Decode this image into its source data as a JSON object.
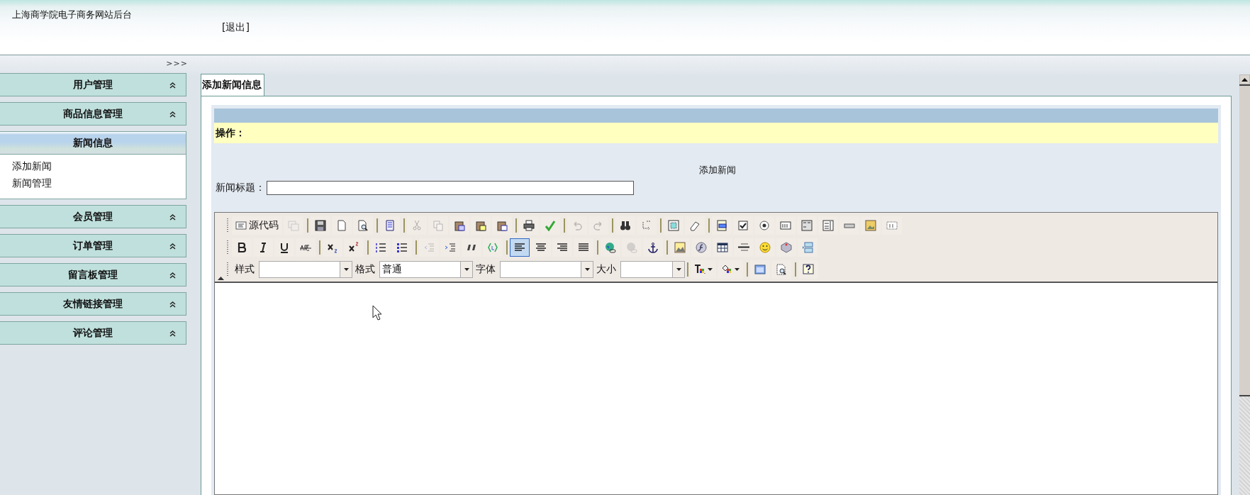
{
  "header": {
    "title": "上海商学院电子商务网站后台",
    "logout": "[退出]"
  },
  "sidebar": {
    "toggle": ">>>",
    "sections": [
      {
        "title": "用户管理",
        "expanded": false
      },
      {
        "title": "商品信息管理",
        "expanded": false
      },
      {
        "title": "新闻信息",
        "expanded": true,
        "items": [
          "添加新闻",
          "新闻管理"
        ]
      },
      {
        "title": "会员管理",
        "expanded": false
      },
      {
        "title": "订单管理",
        "expanded": false
      },
      {
        "title": "留言板管理",
        "expanded": false
      },
      {
        "title": "友情链接管理",
        "expanded": false
      },
      {
        "title": "评论管理",
        "expanded": false
      }
    ]
  },
  "tabs": [
    {
      "label": "添加新闻信息",
      "selected": true
    }
  ],
  "operation_bar": {
    "label": "操作："
  },
  "form": {
    "heading": "添加新闻",
    "title_label": "新闻标题："
  },
  "editor": {
    "toolbar_rows": [
      [
        {
          "kind": "source",
          "label": "源代码",
          "disabled": false,
          "selected": false
        },
        {
          "kind": "templates-doc",
          "disabled": true,
          "selected": false
        },
        {
          "kind": "separator"
        },
        {
          "kind": "save",
          "disabled": false,
          "selected": false
        },
        {
          "kind": "new-page",
          "disabled": false,
          "selected": false
        },
        {
          "kind": "preview",
          "disabled": false,
          "selected": false
        },
        {
          "kind": "separator"
        },
        {
          "kind": "template",
          "disabled": false,
          "selected": false
        },
        {
          "kind": "separator"
        },
        {
          "kind": "cut",
          "disabled": true,
          "selected": false
        },
        {
          "kind": "copy",
          "disabled": true,
          "selected": false
        },
        {
          "kind": "paste",
          "disabled": false,
          "selected": false
        },
        {
          "kind": "paste-text",
          "disabled": false,
          "selected": false
        },
        {
          "kind": "paste-word",
          "disabled": false,
          "selected": false
        },
        {
          "kind": "separator"
        },
        {
          "kind": "print",
          "disabled": false,
          "selected": false
        },
        {
          "kind": "spellcheck",
          "disabled": false,
          "selected": false
        },
        {
          "kind": "separator"
        },
        {
          "kind": "undo",
          "disabled": true,
          "selected": false
        },
        {
          "kind": "redo",
          "disabled": true,
          "selected": false
        },
        {
          "kind": "separator"
        },
        {
          "kind": "find",
          "disabled": false,
          "selected": false
        },
        {
          "kind": "replace",
          "disabled": false,
          "selected": false
        },
        {
          "kind": "separator"
        },
        {
          "kind": "select-all",
          "disabled": false,
          "selected": false
        },
        {
          "kind": "eraser",
          "disabled": false,
          "selected": false
        },
        {
          "kind": "separator"
        },
        {
          "kind": "form",
          "disabled": false,
          "selected": false
        },
        {
          "kind": "checkbox",
          "disabled": false,
          "selected": false
        },
        {
          "kind": "radio",
          "disabled": false,
          "selected": false
        },
        {
          "kind": "textfield",
          "disabled": false,
          "selected": false
        },
        {
          "kind": "textarea",
          "disabled": false,
          "selected": false
        },
        {
          "kind": "select",
          "disabled": false,
          "selected": false
        },
        {
          "kind": "button",
          "disabled": false,
          "selected": false
        },
        {
          "kind": "image-button",
          "disabled": false,
          "selected": false
        },
        {
          "kind": "hidden-field",
          "disabled": false,
          "selected": false
        }
      ],
      [
        {
          "kind": "bold",
          "disabled": false,
          "selected": false
        },
        {
          "kind": "italic",
          "disabled": false,
          "selected": false
        },
        {
          "kind": "underline",
          "disabled": false,
          "selected": false
        },
        {
          "kind": "strike",
          "disabled": false,
          "selected": false
        },
        {
          "kind": "separator"
        },
        {
          "kind": "subscript",
          "disabled": false,
          "selected": false
        },
        {
          "kind": "superscript",
          "disabled": false,
          "selected": false
        },
        {
          "kind": "separator"
        },
        {
          "kind": "ordered-list",
          "disabled": false,
          "selected": false
        },
        {
          "kind": "bulleted-list",
          "disabled": false,
          "selected": false
        },
        {
          "kind": "separator"
        },
        {
          "kind": "outdent",
          "disabled": true,
          "selected": false
        },
        {
          "kind": "indent",
          "disabled": false,
          "selected": false
        },
        {
          "kind": "blockquote",
          "disabled": false,
          "selected": false
        },
        {
          "kind": "div",
          "disabled": false,
          "selected": false
        },
        {
          "kind": "separator"
        },
        {
          "kind": "align-left",
          "disabled": false,
          "selected": true
        },
        {
          "kind": "align-center",
          "disabled": false,
          "selected": false
        },
        {
          "kind": "align-right",
          "disabled": false,
          "selected": false
        },
        {
          "kind": "align-justify",
          "disabled": false,
          "selected": false
        },
        {
          "kind": "separator"
        },
        {
          "kind": "link",
          "disabled": false,
          "selected": false
        },
        {
          "kind": "unlink",
          "disabled": true,
          "selected": false
        },
        {
          "kind": "anchor",
          "disabled": false,
          "selected": false
        },
        {
          "kind": "separator"
        },
        {
          "kind": "image",
          "disabled": false,
          "selected": false
        },
        {
          "kind": "flash",
          "disabled": false,
          "selected": false
        },
        {
          "kind": "table",
          "disabled": false,
          "selected": false
        },
        {
          "kind": "rule",
          "disabled": false,
          "selected": false
        },
        {
          "kind": "smiley",
          "disabled": false,
          "selected": false
        },
        {
          "kind": "special-char",
          "disabled": false,
          "selected": false
        },
        {
          "kind": "page-break",
          "disabled": false,
          "selected": false
        }
      ],
      [
        {
          "kind": "combo",
          "label": "样式"
        },
        {
          "kind": "combo",
          "label": "格式",
          "value": "普通"
        },
        {
          "kind": "combo",
          "label": "字体"
        },
        {
          "kind": "combo",
          "label": "大小"
        },
        {
          "kind": "separator"
        },
        {
          "kind": "text-color",
          "disabled": false,
          "selected": false
        },
        {
          "kind": "bg-color",
          "disabled": false,
          "selected": false
        },
        {
          "kind": "separator"
        },
        {
          "kind": "maximize",
          "disabled": false,
          "selected": false
        },
        {
          "kind": "show-blocks",
          "disabled": false,
          "selected": false
        },
        {
          "kind": "separator"
        },
        {
          "kind": "about",
          "disabled": false,
          "selected": false
        }
      ]
    ]
  }
}
